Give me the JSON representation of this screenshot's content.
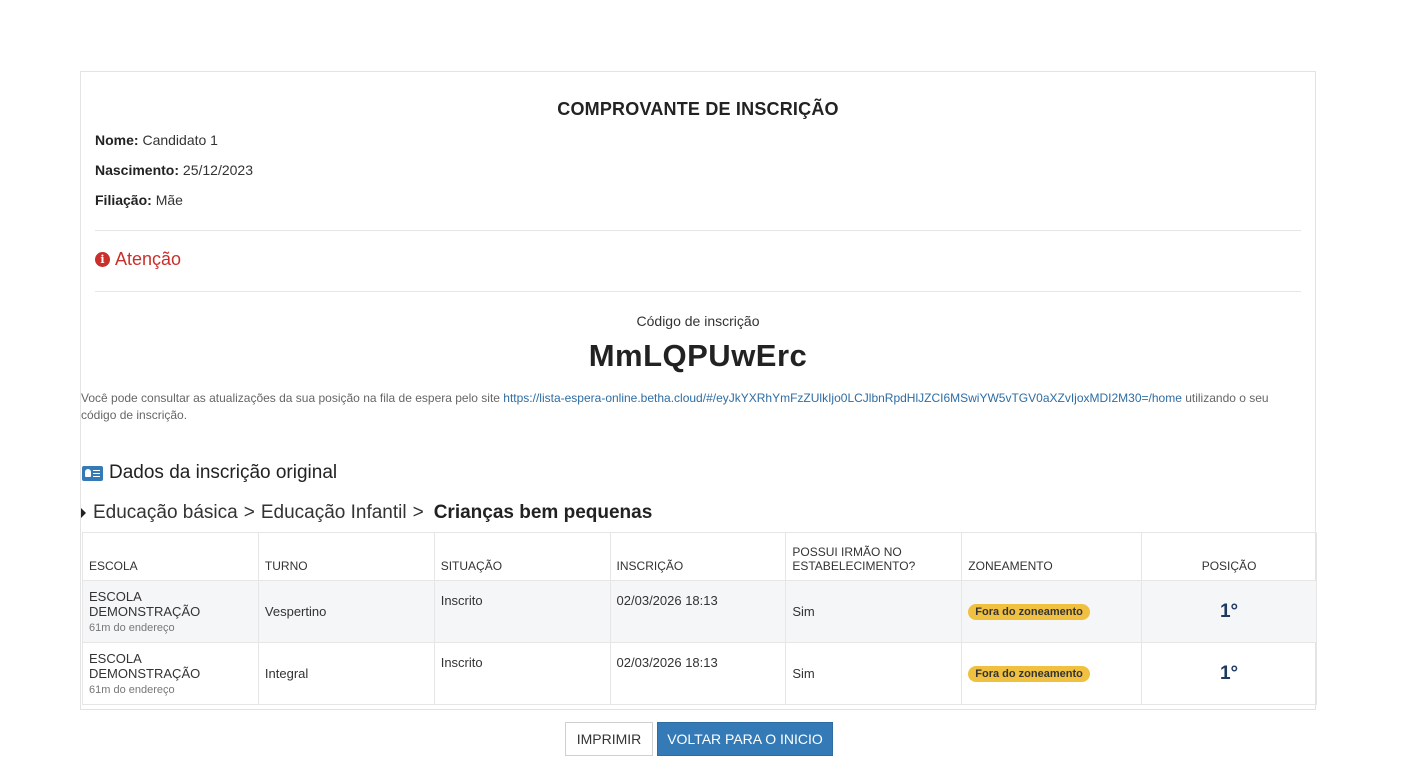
{
  "receipt": {
    "title": "COMPROVANTE DE INSCRIÇÃO",
    "name_label": "Nome:",
    "name_value": "Candidato 1",
    "birth_label": "Nascimento:",
    "birth_value": "25/12/2023",
    "parent_label": "Filiação:",
    "parent_value": "Mãe",
    "attention": "Atenção",
    "code_label": "Código de inscrição",
    "code": "MmLQPUwErc",
    "info_prefix": "Você pode consultar as atualizações da sua posição na fila de espera pelo site ",
    "info_link": "https://lista-espera-online.betha.cloud/#/eyJkYXRhYmFzZUlkIjo0LCJlbnRpdHlJZCI6MSwiYW5vTGV0aXZvIjoxMDI2M30=/home",
    "info_suffix": " utilizando o seu código de inscrição."
  },
  "section": {
    "title": "Dados da inscrição original",
    "breadcrumb_1": "Educação básica",
    "separator": ">",
    "breadcrumb_2": "Educação Infantil",
    "breadcrumb_3": "Crianças bem pequenas"
  },
  "table": {
    "headers": [
      "ESCOLA",
      "TURNO",
      "SITUAÇÃO",
      "INSCRIÇÃO",
      "POSSUI IRMÃO NO ESTABELECIMENTO?",
      "ZONEAMENTO",
      "POSIÇÃO"
    ],
    "rows": [
      {
        "school": "ESCOLA DEMONSTRAÇÃO",
        "distance": "61m do endereço",
        "shift": "Vespertino",
        "status": "Inscrito",
        "date": "02/03/2026 18:13",
        "sibling": "Sim",
        "zoning": "Fora do zoneamento",
        "position": "1°"
      },
      {
        "school": "ESCOLA DEMONSTRAÇÃO",
        "distance": "61m do endereço",
        "shift": "Integral",
        "status": "Inscrito",
        "date": "02/03/2026 18:13",
        "sibling": "Sim",
        "zoning": "Fora do zoneamento",
        "position": "1°"
      }
    ]
  },
  "actions": {
    "print_label": "IMPRIMIR",
    "home_label": "VOLTAR PARA O INICIO"
  },
  "colors": {
    "primary": "#337ab7",
    "danger": "#c9302c",
    "badge": "#f0c040",
    "position": "#1f3a60"
  },
  "icons": {
    "attention": "info-circle-icon",
    "section": "id-card-icon",
    "breadcrumb": "caret-right-icon"
  }
}
